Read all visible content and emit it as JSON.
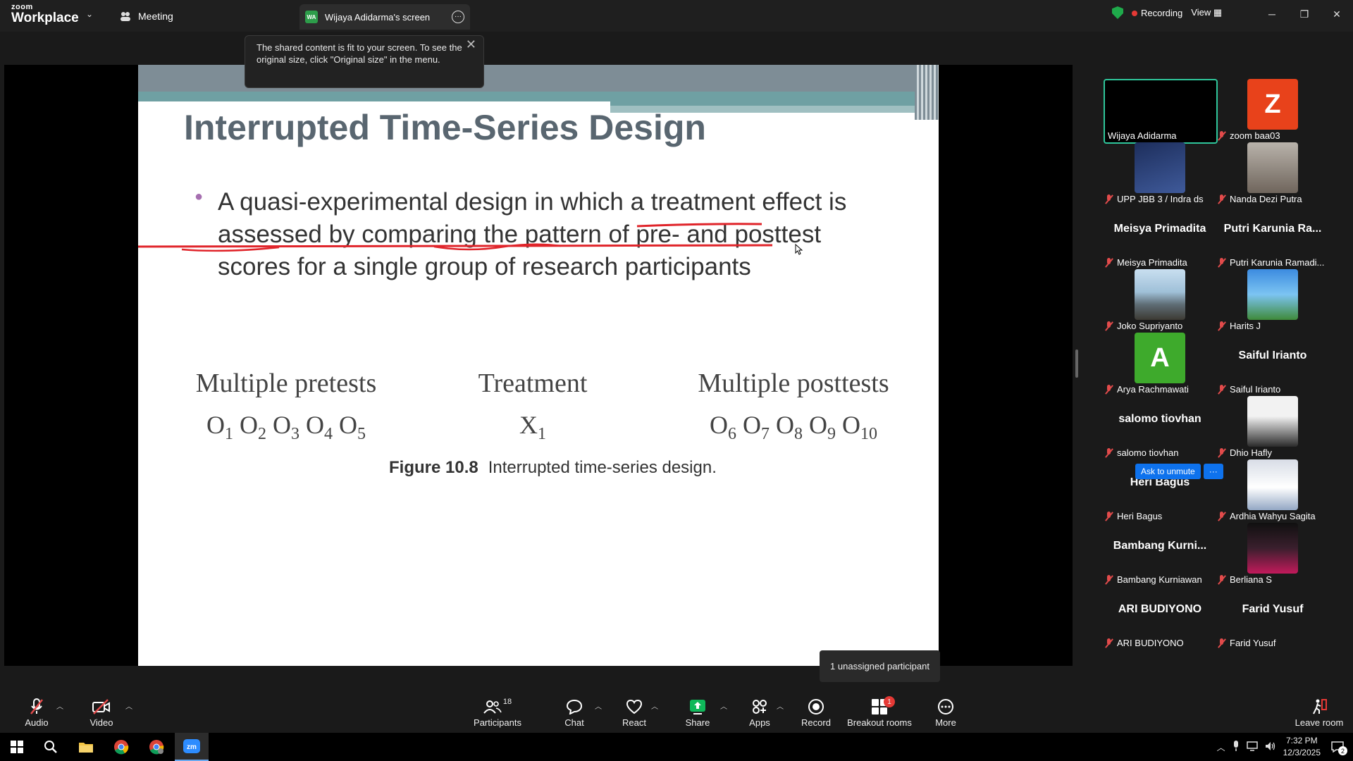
{
  "topbar": {
    "logo_top": "zoom",
    "logo_bottom": "Workplace",
    "meeting_label": "Meeting",
    "screen_tab_badge": "WA",
    "screen_tab_label": "Wijaya Adidarma's screen",
    "recording_label": "Recording",
    "view_label": "View"
  },
  "tooltip": {
    "text": "The shared content is fit to your screen. To see the original size, click \"Original size\" in the menu."
  },
  "slide": {
    "title": "Interrupted Time-Series Design",
    "bullet": "A quasi-experimental design in which a treatment effect is assessed by comparing the pattern of pre- and posttest scores for a single group of research participants",
    "figure": {
      "pretests_header": "Multiple pretests",
      "treatment_header": "Treatment",
      "posttests_header": "Multiple posttests",
      "pretest_obs": [
        "1",
        "2",
        "3",
        "4",
        "5"
      ],
      "treatment_obs": "1",
      "posttest_obs": [
        "6",
        "7",
        "8",
        "9",
        "10"
      ],
      "caption_label": "Figure 10.8",
      "caption_text": "Interrupted time-series design."
    }
  },
  "unassigned_text": "1 unassigned participant",
  "gallery": {
    "active": {
      "name": "Wijaya Adidarma"
    },
    "ask_unmute": "Ask to unmute",
    "tiles": [
      {
        "name": "zoom baa03",
        "avatar_letter": "Z",
        "avatar_color": "#e8421b"
      },
      {
        "name": "UPP JBB 3 / Indra ds"
      },
      {
        "name": "Nanda Dezi Putra"
      },
      {
        "name": "Meisya Primadita",
        "big": "Meisya Primadita"
      },
      {
        "name": "Putri Karunia Ramadi...",
        "big": "Putri Karunia Ra..."
      },
      {
        "name": "Joko Supriyanto"
      },
      {
        "name": "Harits J"
      },
      {
        "name": "Arya Rachmawati",
        "avatar_letter": "A",
        "avatar_color": "#3eaa2c"
      },
      {
        "name": "Saiful Irianto",
        "big": "Saiful Irianto"
      },
      {
        "name": "salomo tiovhan",
        "big": "salomo tiovhan"
      },
      {
        "name": "Dhio Hafly"
      },
      {
        "name": "Heri Bagus",
        "big": "Heri Bagus"
      },
      {
        "name": "Ardhia Wahyu Sagita"
      },
      {
        "name": "Bambang Kurniawan",
        "big": "Bambang  Kurni..."
      },
      {
        "name": "Berliana S"
      },
      {
        "name": "ARI BUDIYONO",
        "big": "ARI BUDIYONO"
      },
      {
        "name": "Farid Yusuf",
        "big": "Farid Yusuf"
      }
    ]
  },
  "toolbar": {
    "audio": "Audio",
    "video": "Video",
    "participants": "Participants",
    "participants_count": "18",
    "chat": "Chat",
    "react": "React",
    "share": "Share",
    "apps": "Apps",
    "record": "Record",
    "breakout": "Breakout rooms",
    "breakout_badge": "1",
    "more": "More",
    "leave": "Leave room"
  },
  "taskbar": {
    "time": "7:32 PM",
    "date": "12/3/2025",
    "notif_count": "2"
  },
  "colors": {
    "accent_blue": "#0e72ed",
    "active_border": "#2fc69b",
    "share_green": "#0fb85a",
    "muted_red": "#e24b4b"
  }
}
